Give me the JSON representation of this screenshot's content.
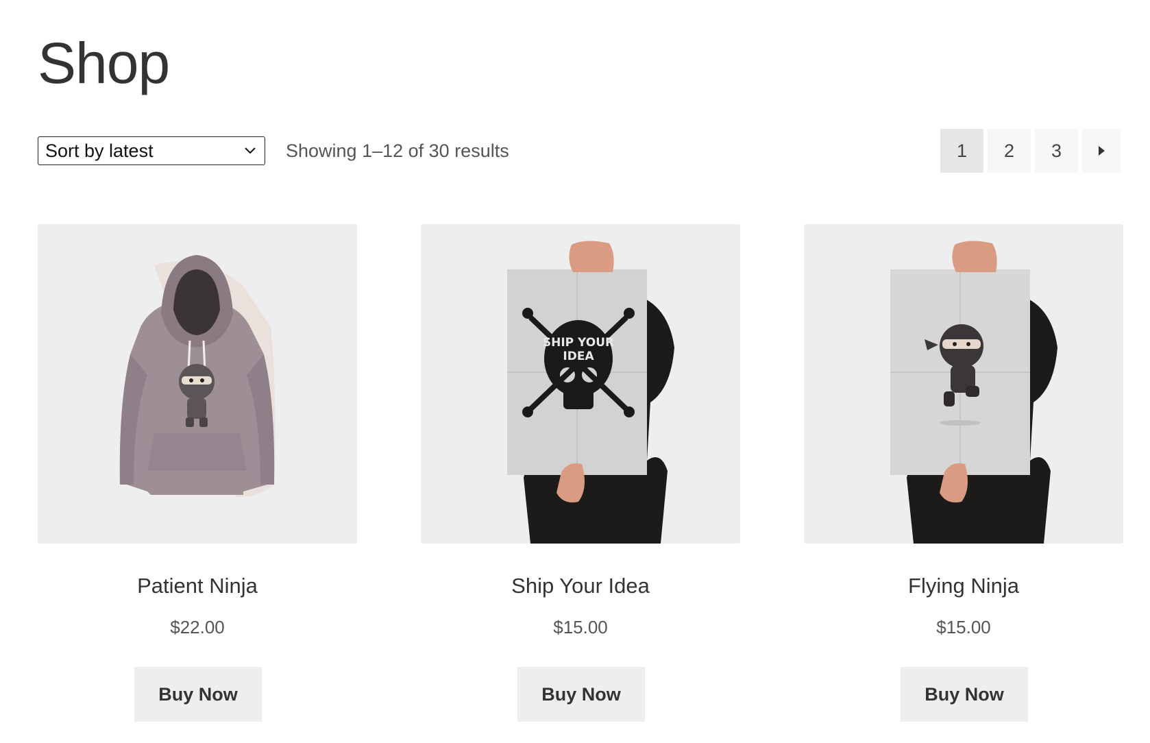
{
  "page": {
    "title": "Shop"
  },
  "toolbar": {
    "sort_selected": "Sort by latest",
    "result_count": "Showing 1–12 of 30 results"
  },
  "pagination": {
    "pages": [
      "1",
      "2",
      "3"
    ],
    "current": "1",
    "next_icon": "next-arrow-icon"
  },
  "products": [
    {
      "title": "Patient Ninja",
      "price": "$22.00",
      "button": "Buy Now",
      "image": "hoodie-ninja-image"
    },
    {
      "title": "Ship Your Idea",
      "price": "$15.00",
      "button": "Buy Now",
      "image": "ship-your-idea-poster-image",
      "poster_text": [
        "SHIP YOUR",
        "IDEA"
      ]
    },
    {
      "title": "Flying Ninja",
      "price": "$15.00",
      "button": "Buy Now",
      "image": "flying-ninja-poster-image"
    }
  ],
  "colors": {
    "card_bg": "#eeeeee",
    "button_bg": "#eeeeee",
    "page_current_bg": "#e6e6e6",
    "page_bg": "#f6f6f6",
    "text": "#333333"
  }
}
